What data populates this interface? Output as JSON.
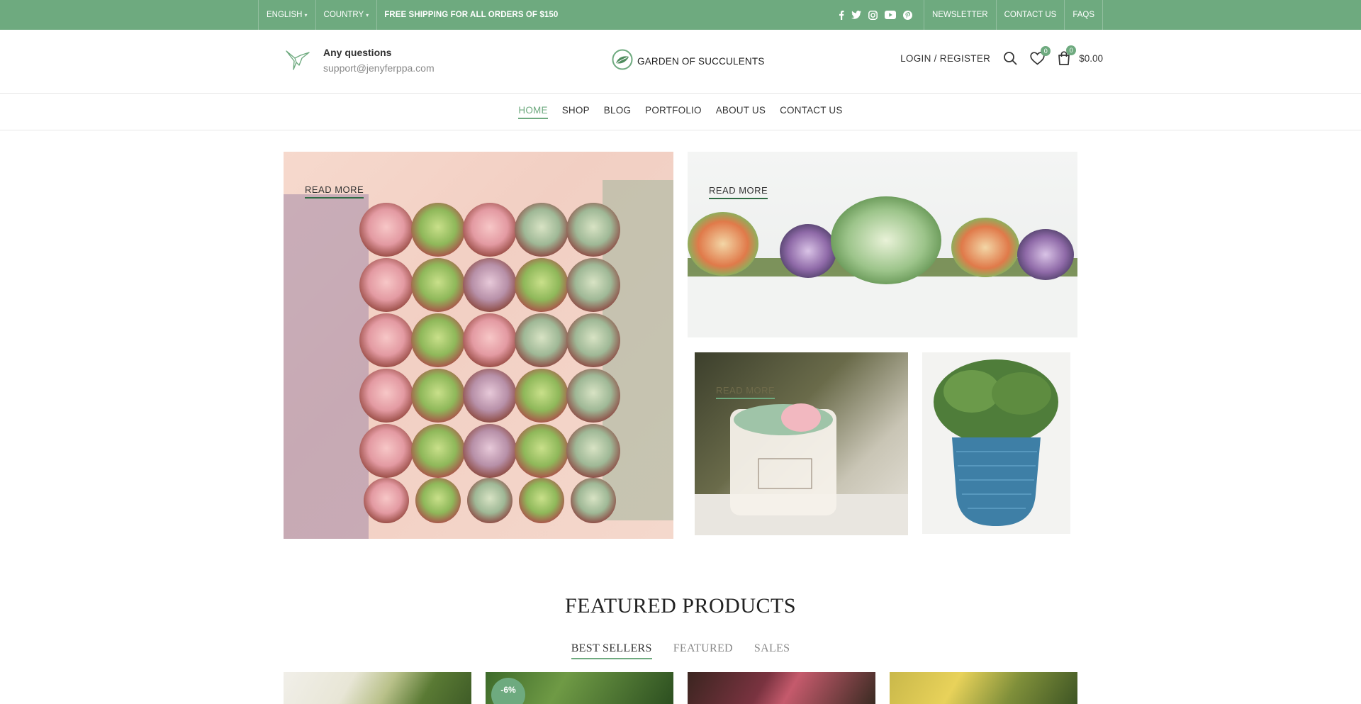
{
  "topbar": {
    "language": "ENGLISH",
    "country": "COUNTRY",
    "shipping": "FREE SHIPPING FOR ALL ORDERS OF $150",
    "social": [
      "facebook-icon",
      "twitter-icon",
      "instagram-icon",
      "youtube-icon",
      "pinterest-icon"
    ],
    "links": [
      "NEWSLETTER",
      "CONTACT US",
      "FAQS"
    ]
  },
  "header": {
    "questions_title": "Any questions",
    "questions_email": "support@jenyferppa.com",
    "logo_text": "GARDEN OF SUCCULENTS",
    "login": "LOGIN / REGISTER",
    "wishlist_count": "0",
    "cart_count": "0",
    "cart_total": "$0.00"
  },
  "nav": {
    "items": [
      "HOME",
      "SHOP",
      "BLOG",
      "PORTFOLIO",
      "ABOUT US",
      "CONTACT US"
    ],
    "active": "HOME"
  },
  "banners": {
    "read_more": "READ MORE"
  },
  "featured": {
    "title": "FEATURED PRODUCTS",
    "tabs": [
      "BEST SELLERS",
      "FEATURED",
      "SALES"
    ],
    "active_tab": "BEST SELLERS",
    "sale_badge": "-6%"
  },
  "colors": {
    "accent": "#6eaa7f",
    "dark_green": "#2f6b44"
  }
}
